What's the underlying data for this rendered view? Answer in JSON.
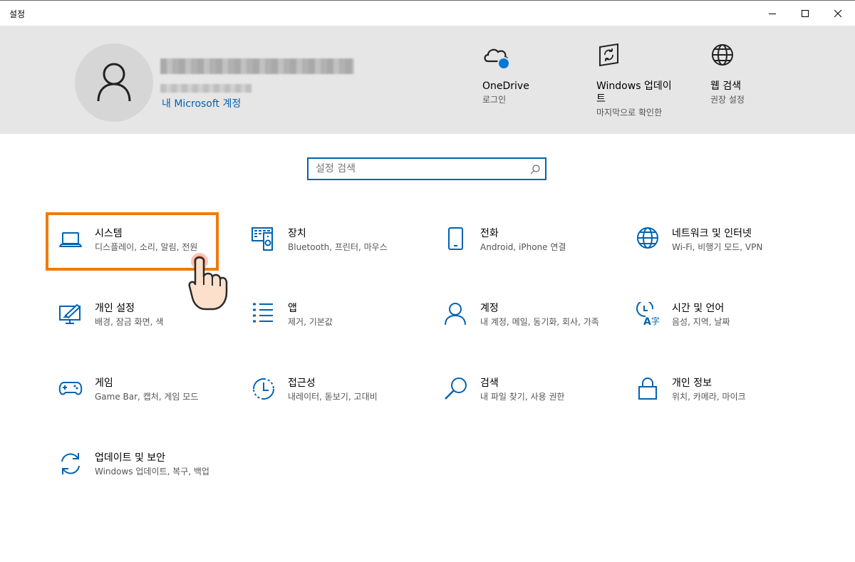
{
  "window": {
    "title": "설정",
    "controls": [
      "minimize-icon",
      "maximize-icon",
      "close-icon"
    ]
  },
  "header": {
    "account_link": "내 Microsoft 계정",
    "items": [
      {
        "name": "OneDrive",
        "sub": "로그인",
        "icon": "onedrive-cloud-icon"
      },
      {
        "name": "Windows 업데이트",
        "sub": "마지막으로 확인한",
        "icon": "windows-update-icon"
      },
      {
        "name": "웹 검색",
        "sub": "권장 설정",
        "icon": "globe-icon"
      }
    ]
  },
  "search": {
    "placeholder": "설정 검색"
  },
  "categories": [
    {
      "name": "시스템",
      "sub": "디스플레이, 소리, 알림, 전원",
      "icon": "laptop-icon"
    },
    {
      "name": "장치",
      "sub": "Bluetooth, 프린터, 마우스",
      "icon": "devices-icon"
    },
    {
      "name": "전화",
      "sub": "Android, iPhone 연결",
      "icon": "phone-icon"
    },
    {
      "name": "네트워크 및 인터넷",
      "sub": "Wi-Fi, 비행기 모드, VPN",
      "icon": "globe-icon"
    },
    {
      "name": "개인 설정",
      "sub": "배경, 잠금 화면, 색",
      "icon": "personalization-icon"
    },
    {
      "name": "앱",
      "sub": "제거, 기본값",
      "icon": "apps-list-icon"
    },
    {
      "name": "계정",
      "sub": "내 계정, 메일, 동기화, 회사, 가족",
      "icon": "person-icon"
    },
    {
      "name": "시간 및 언어",
      "sub": "음성, 지역, 날짜",
      "icon": "time-language-icon"
    },
    {
      "name": "게임",
      "sub": "Game Bar, 캡처, 게임 모드",
      "icon": "gamepad-icon"
    },
    {
      "name": "접근성",
      "sub": "내레이터, 돋보기, 고대비",
      "icon": "accessibility-icon"
    },
    {
      "name": "검색",
      "sub": "내 파일 찾기, 사용 권한",
      "icon": "magnifier-icon"
    },
    {
      "name": "개인 정보",
      "sub": "위치, 카메라, 마이크",
      "icon": "lock-icon"
    },
    {
      "name": "업데이트 및 보안",
      "sub": "Windows 업데이트, 복구, 백업",
      "icon": "update-icon"
    }
  ],
  "colors": {
    "accent": "#0063b1",
    "highlight": "#f07b0a",
    "header_bg": "#e6e6e6"
  }
}
